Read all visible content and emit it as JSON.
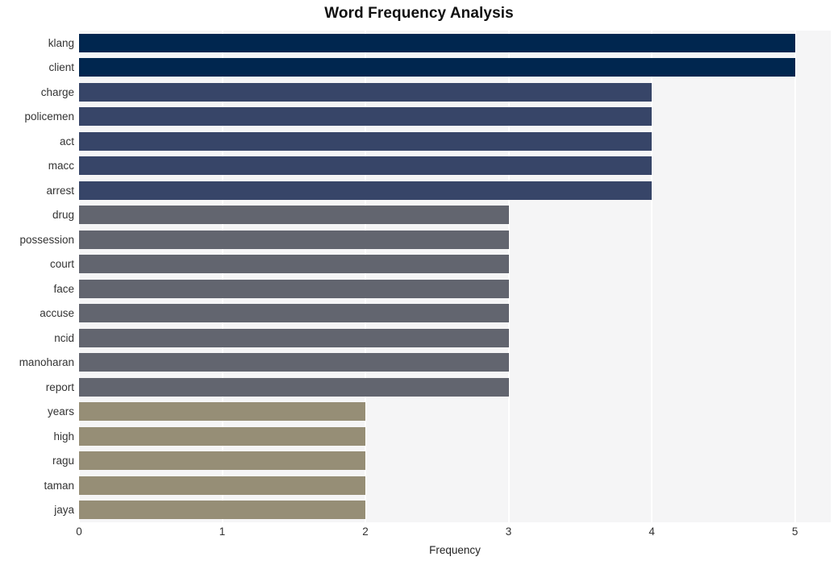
{
  "chart_data": {
    "type": "bar",
    "orientation": "horizontal",
    "title": "Word Frequency Analysis",
    "xlabel": "Frequency",
    "ylabel": "",
    "xlim": [
      0,
      5.25
    ],
    "xticks": [
      "0",
      "1",
      "2",
      "3",
      "4",
      "5"
    ],
    "xtick_values": [
      0,
      1,
      2,
      3,
      4,
      5
    ],
    "grid": "vertical-white",
    "legend": "none",
    "categories": [
      "klang",
      "client",
      "charge",
      "policemen",
      "act",
      "macc",
      "arrest",
      "drug",
      "possession",
      "court",
      "face",
      "accuse",
      "ncid",
      "manoharan",
      "report",
      "years",
      "high",
      "ragu",
      "taman",
      "jaya"
    ],
    "values": [
      5,
      5,
      4,
      4,
      4,
      4,
      4,
      3,
      3,
      3,
      3,
      3,
      3,
      3,
      3,
      2,
      2,
      2,
      2,
      2
    ],
    "bar_colors": [
      "#00264f",
      "#00264f",
      "#374568",
      "#374568",
      "#374568",
      "#374568",
      "#374568",
      "#62656f",
      "#62656f",
      "#62656f",
      "#62656f",
      "#62656f",
      "#62656f",
      "#62656f",
      "#62656f",
      "#968e76",
      "#968e76",
      "#968e76",
      "#968e76",
      "#968e76"
    ]
  },
  "style": {
    "plot_background": "#f5f5f6",
    "figure_background": "#ffffff",
    "gridline_color": "#ffffff",
    "tick_label_color": "#333333",
    "title_color": "#111111"
  }
}
